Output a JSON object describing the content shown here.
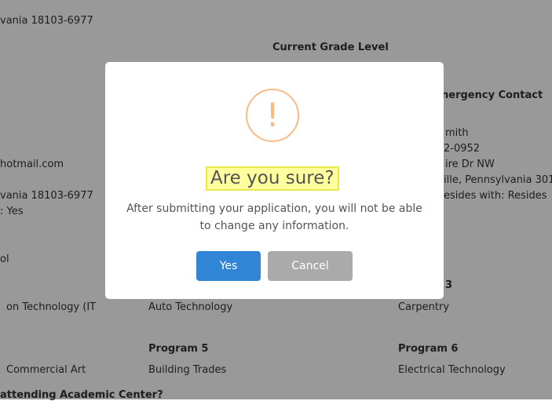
{
  "background": {
    "lines": [
      "vania 18103-6977",
      "hotmail.com",
      "vania 18103-6977",
      ": Yes",
      "ol",
      "on Technology (IT",
      "Commercial Art",
      "mith",
      "2-0952",
      "ire Dr NW",
      "ille, Pennsylvania 301",
      "esides with: Resides",
      "Auto Technology",
      "Carpentry",
      "Building Trades",
      "Electrical Technology"
    ],
    "headings": [
      "Current Grade Level",
      "nergency Contact",
      "3",
      "Program 5",
      "Program 6",
      "attending Academic Center?"
    ]
  },
  "dialog": {
    "title": "Are you sure?",
    "icon": "!",
    "message": "After submitting your application, you will not be able to change any information.",
    "confirm_label": "Yes",
    "cancel_label": "Cancel"
  },
  "colors": {
    "confirm": "#3085d6",
    "cancel": "#aaaaaa",
    "warning": "#f8bb86",
    "highlight": "#ffff9e"
  }
}
